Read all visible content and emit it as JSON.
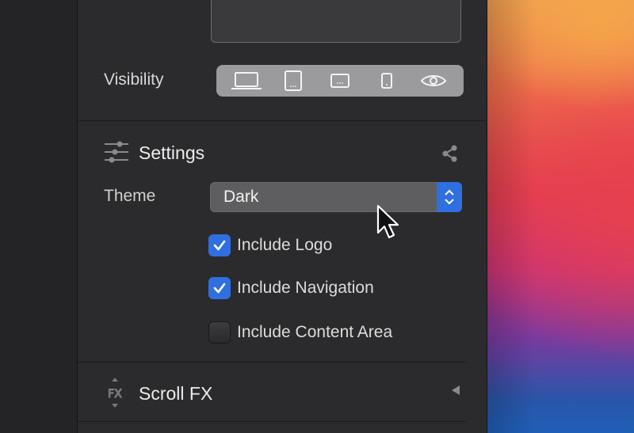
{
  "visibility": {
    "label": "Visibility",
    "devices": [
      "laptop-icon",
      "tablet-icon",
      "tablet-landscape-icon",
      "phone-icon",
      "eye-icon"
    ]
  },
  "settings": {
    "title": "Settings",
    "theme_label": "Theme",
    "theme_value": "Dark",
    "options": [
      {
        "label": "Include Logo",
        "checked": true
      },
      {
        "label": "Include Navigation",
        "checked": true
      },
      {
        "label": "Include Content Area",
        "checked": false
      }
    ]
  },
  "scroll_fx": {
    "title": "Scroll FX"
  },
  "colors": {
    "accent": "#2f6fe0",
    "panel": "#2b2b2d"
  }
}
